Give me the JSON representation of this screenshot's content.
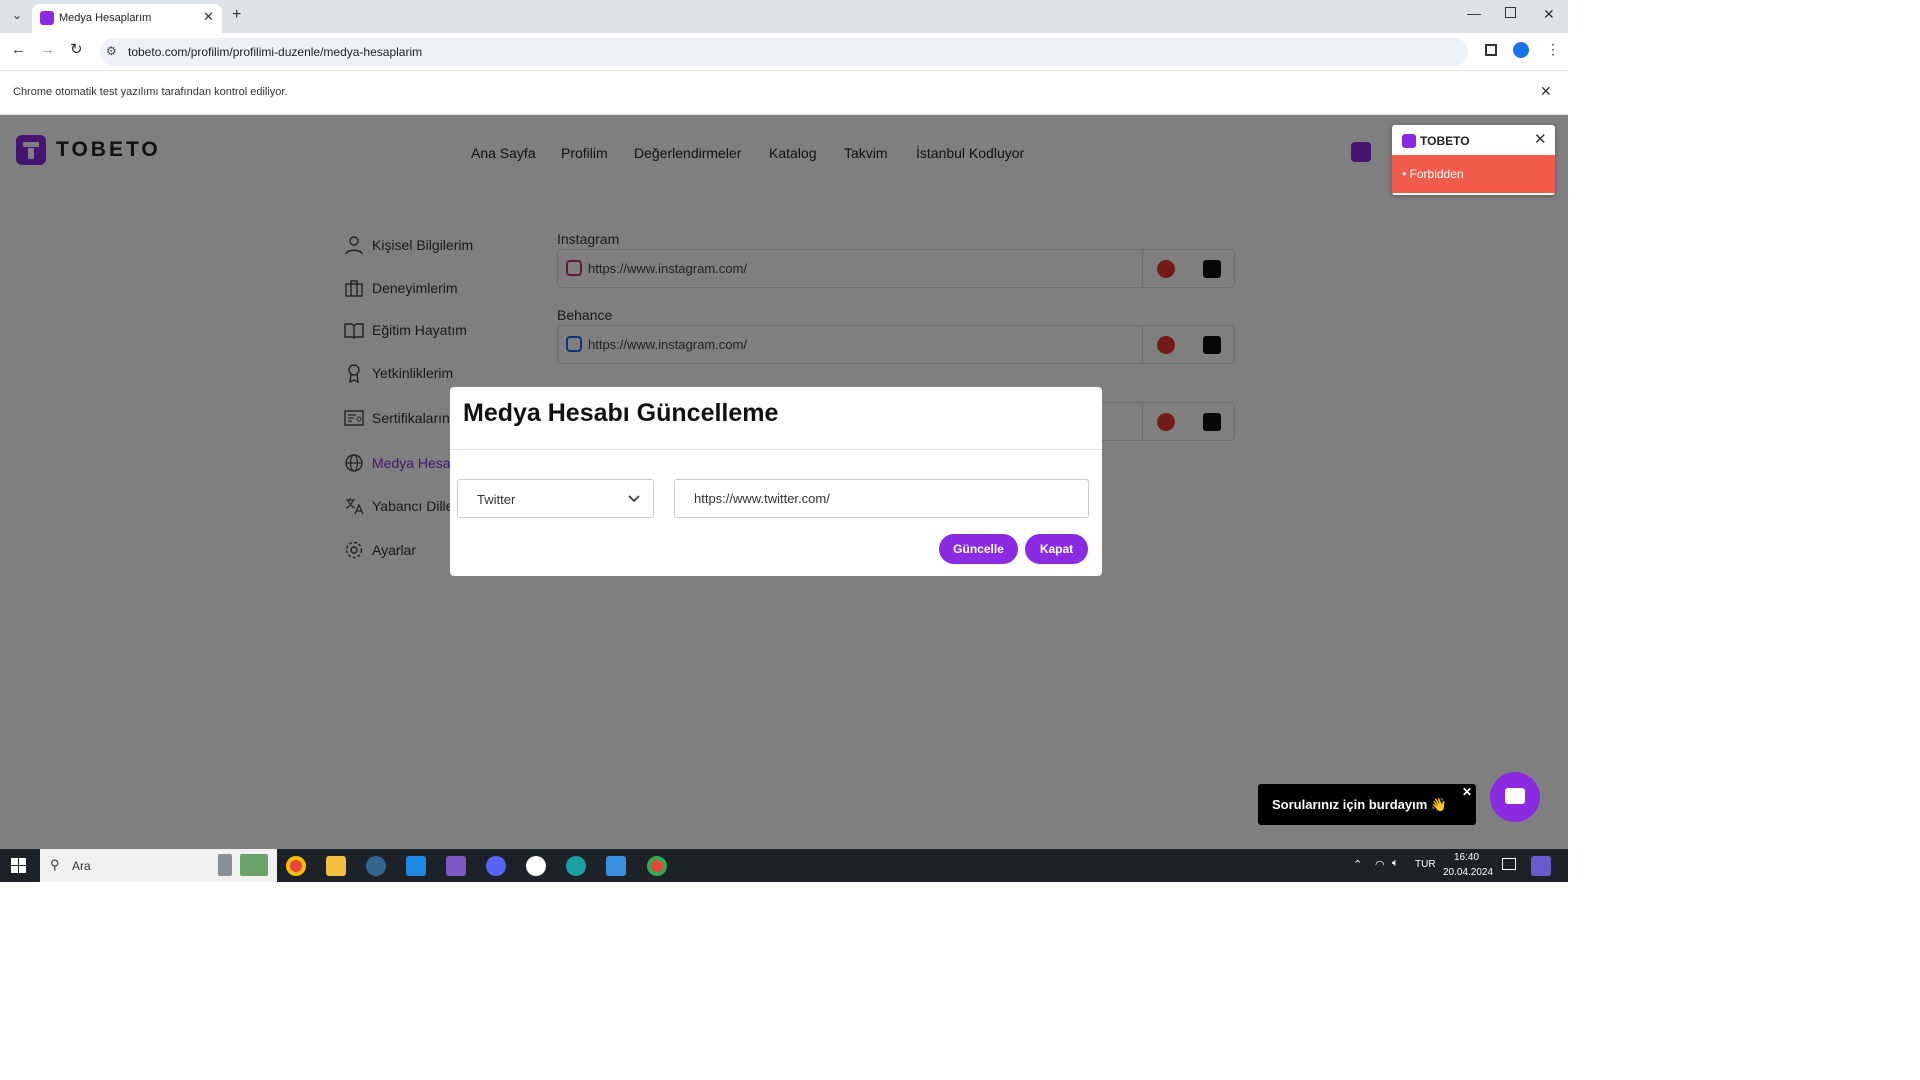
{
  "browser": {
    "tab_title": "Medya Hesaplarım",
    "url": "tobeto.com/profilim/profilimi-duzenle/medya-hesaplarim",
    "infobar_text": "Chrome otomatik test yazılımı tarafından kontrol ediliyor."
  },
  "site": {
    "logo_text": "TOBETO",
    "nav": [
      "Ana Sayfa",
      "Profilim",
      "Değerlendirmeler",
      "Katalog",
      "Takvim",
      "İstanbul Kodluyor"
    ]
  },
  "sidebar": {
    "items": [
      "Kişisel Bilgilerim",
      "Deneyimlerim",
      "Eğitim Hayatım",
      "Yetkinliklerim",
      "Sertifikaların",
      "Medya Hesa",
      "Yabancı Dille",
      "Ayarlar"
    ],
    "active_index": 5
  },
  "media_accounts": [
    {
      "label": "Instagram",
      "value": "https://www.instagram.com/"
    },
    {
      "label": "Behance",
      "value": "https://www.instagram.com/"
    },
    {
      "label": "",
      "value": ""
    }
  ],
  "modal": {
    "title": "Medya Hesabı Güncelleme",
    "select_value": "Twitter",
    "url_value": "https://www.twitter.com/",
    "update_button": "Güncelle",
    "close_button": "Kapat"
  },
  "toast": {
    "title": "TOBETO",
    "message": "• Forbidden"
  },
  "chat": {
    "bubble_text": "Sorularınız için burdayım 👋"
  },
  "taskbar": {
    "search_placeholder": "Ara",
    "language": "TUR",
    "time": "16:40",
    "date": "20.04.2024"
  },
  "colors": {
    "brand_purple": "#8a2be2",
    "error_red": "#f15b4c"
  }
}
